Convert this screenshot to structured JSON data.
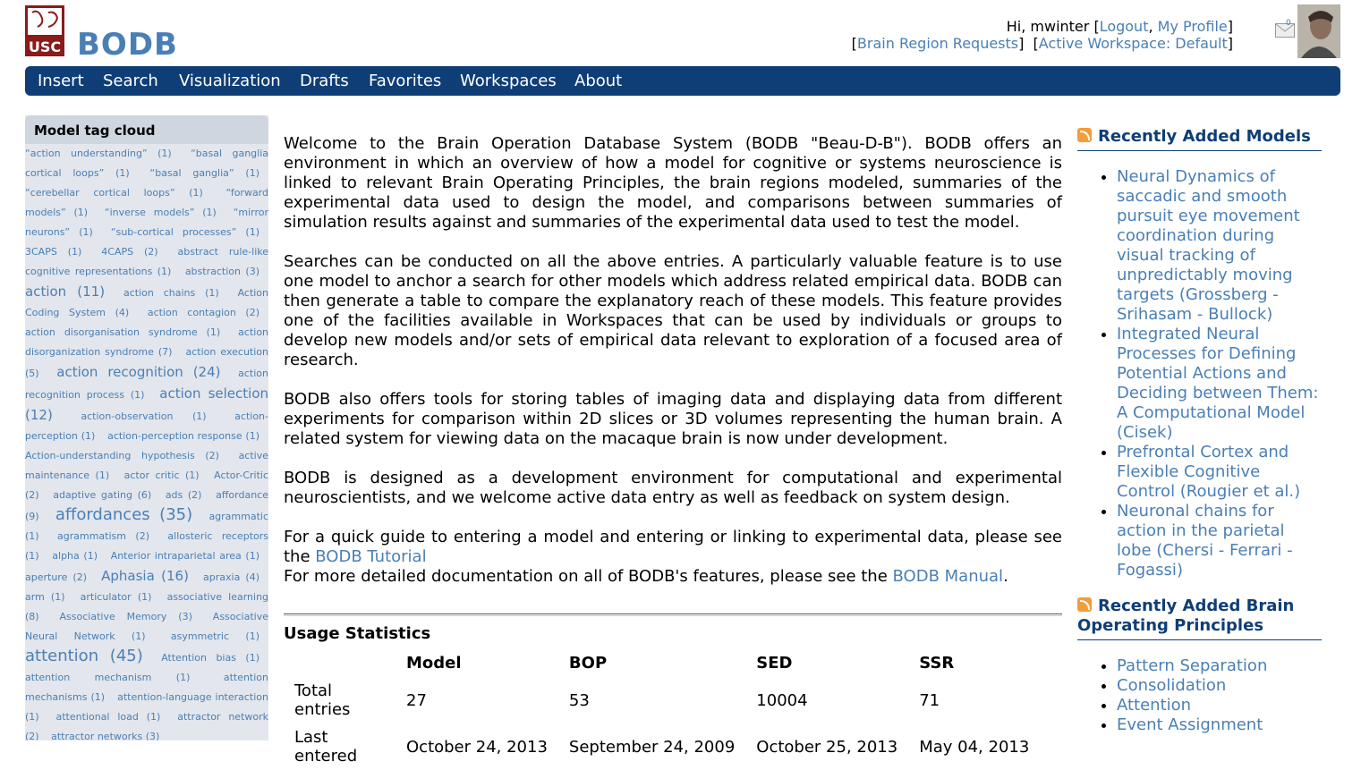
{
  "header": {
    "brand": "BODB",
    "logo_alt": "USC",
    "greeting": "Hi, mwinter",
    "logout": "Logout",
    "profile": "My Profile",
    "region_requests": "Brain Region Requests",
    "workspace": "Active Workspace: Default",
    "mail_count": "0"
  },
  "nav": [
    "Insert",
    "Search",
    "Visualization",
    "Drafts",
    "Favorites",
    "Workspaces",
    "About"
  ],
  "sidebar": {
    "title": "Model tag cloud",
    "tags": [
      "“action understanding” (1)",
      "“basal ganglia cortical loops” (1)",
      "“basal ganglia” (1)",
      "“cerebellar cortical loops” (1)",
      "“forward models” (1)",
      "“inverse models” (1)",
      "“mirror neurons” (1)",
      "“sub-cortical processes” (1)",
      "3CAPS (1)",
      "4CAPS (2)",
      "abstract rule-like cognitive representations (1)",
      "abstraction (3)",
      "action (11)",
      "action chains (1)",
      "Action Coding System (4)",
      "action contagion (2)",
      "action disorganisation syndrome (1)",
      "action disorganization syndrome (7)",
      "action execution (5)",
      "action recognition (24)",
      "action recognition process (1)",
      "action selection (12)",
      "action-observation (1)",
      "action-perception (1)",
      "action-perception response (1)",
      "Action-understanding hypothesis (2)",
      "active maintenance (1)",
      "actor critic (1)",
      "Actor-Critic (2)",
      "adaptive gating (6)",
      "ads (2)",
      "affordance (9)",
      "affordances (35)",
      "agrammatic (1)",
      "agrammatism (2)",
      "allosteric receptors (1)",
      "alpha (1)",
      "Anterior intraparietal area (1)",
      "aperture (2)",
      "Aphasia (16)",
      "apraxia (4)",
      "arm (1)",
      "articulator (1)",
      "associative learning (8)",
      "Associative Memory (3)",
      "Associative Neural Network (1)",
      "asymmetric (1)",
      "attention (45)",
      "Attention bias (1)",
      "attention mechanism (1)",
      "attention mechanisms (1)",
      "attention-language interaction (1)",
      "attentional load (1)",
      "attractor network (2)",
      "attractor networks (3)"
    ]
  },
  "main": {
    "p1": "Welcome to the Brain Operation Database System (BODB \"Beau-D-B\"). BODB offers an environment in which an overview of how a model for cognitive or systems neuroscience is linked to relevant Brain Operating Principles, the brain regions modeled, summaries of the experimental data used to design the model, and comparisons between summaries of simulation results against and summaries of the experimental data used to test the model.",
    "p2": "Searches can be conducted on all the above entries. A particularly valuable feature is to use one model to anchor a search for other models which address related empirical data. BODB can then generate a table to compare the explanatory reach of these models. This feature provides one of the facilities available in Workspaces that can be used by individuals or groups to develop new models and/or sets of empirical data relevant to exploration of a focused area of research.",
    "p3": "BODB also offers tools for storing tables of imaging data and displaying data from different experiments for comparison within 2D slices or 3D volumes representing the human brain. A related system for viewing data on the macaque brain is now under development.",
    "p4": "BODB is designed as a development environment for computational and experimental neuroscientists, and we welcome active data entry as well as feedback on system design.",
    "p5_prefix": "For a quick guide to entering a model and entering or linking to experimental data, please see the ",
    "tutorial_link": "BODB Tutorial",
    "p6_prefix": "For more detailed documentation on all of BODB's features, please see the ",
    "manual_link": "BODB Manual",
    "p6_suffix": "."
  },
  "usage": {
    "title": "Usage Statistics",
    "columns": [
      "",
      "Model",
      "BOP",
      "SED",
      "SSR"
    ],
    "rows": [
      [
        "Total entries",
        "27",
        "53",
        "10004",
        "71"
      ],
      [
        "Last entered",
        "October 24, 2013",
        "September 24, 2009",
        "October 25, 2013",
        "May 04, 2013"
      ]
    ]
  },
  "recent_models": {
    "title": "Recently Added Models",
    "items": [
      "Neural Dynamics of saccadic and smooth pursuit eye movement coordination during visual tracking of unpredictably moving targets (Grossberg - Srihasam - Bullock)",
      "Integrated Neural Processes for Defining Potential Actions and Deciding between Them: A Computational Model (Cisek)",
      "Prefrontal Cortex and Flexible Cognitive Control (Rougier et al.)",
      "Neuronal chains for action in the parietal lobe (Chersi - Ferrari - Fogassi)"
    ]
  },
  "recent_bops": {
    "title": "Recently Added Brain Operating Principles",
    "items": [
      "Pattern Separation",
      "Consolidation",
      "Attention",
      "Event Assignment"
    ]
  },
  "colors": {
    "nav_bg": "#0f3e76",
    "link": "#4a7fb5",
    "sidebar_bg": "#e3e6ec"
  }
}
